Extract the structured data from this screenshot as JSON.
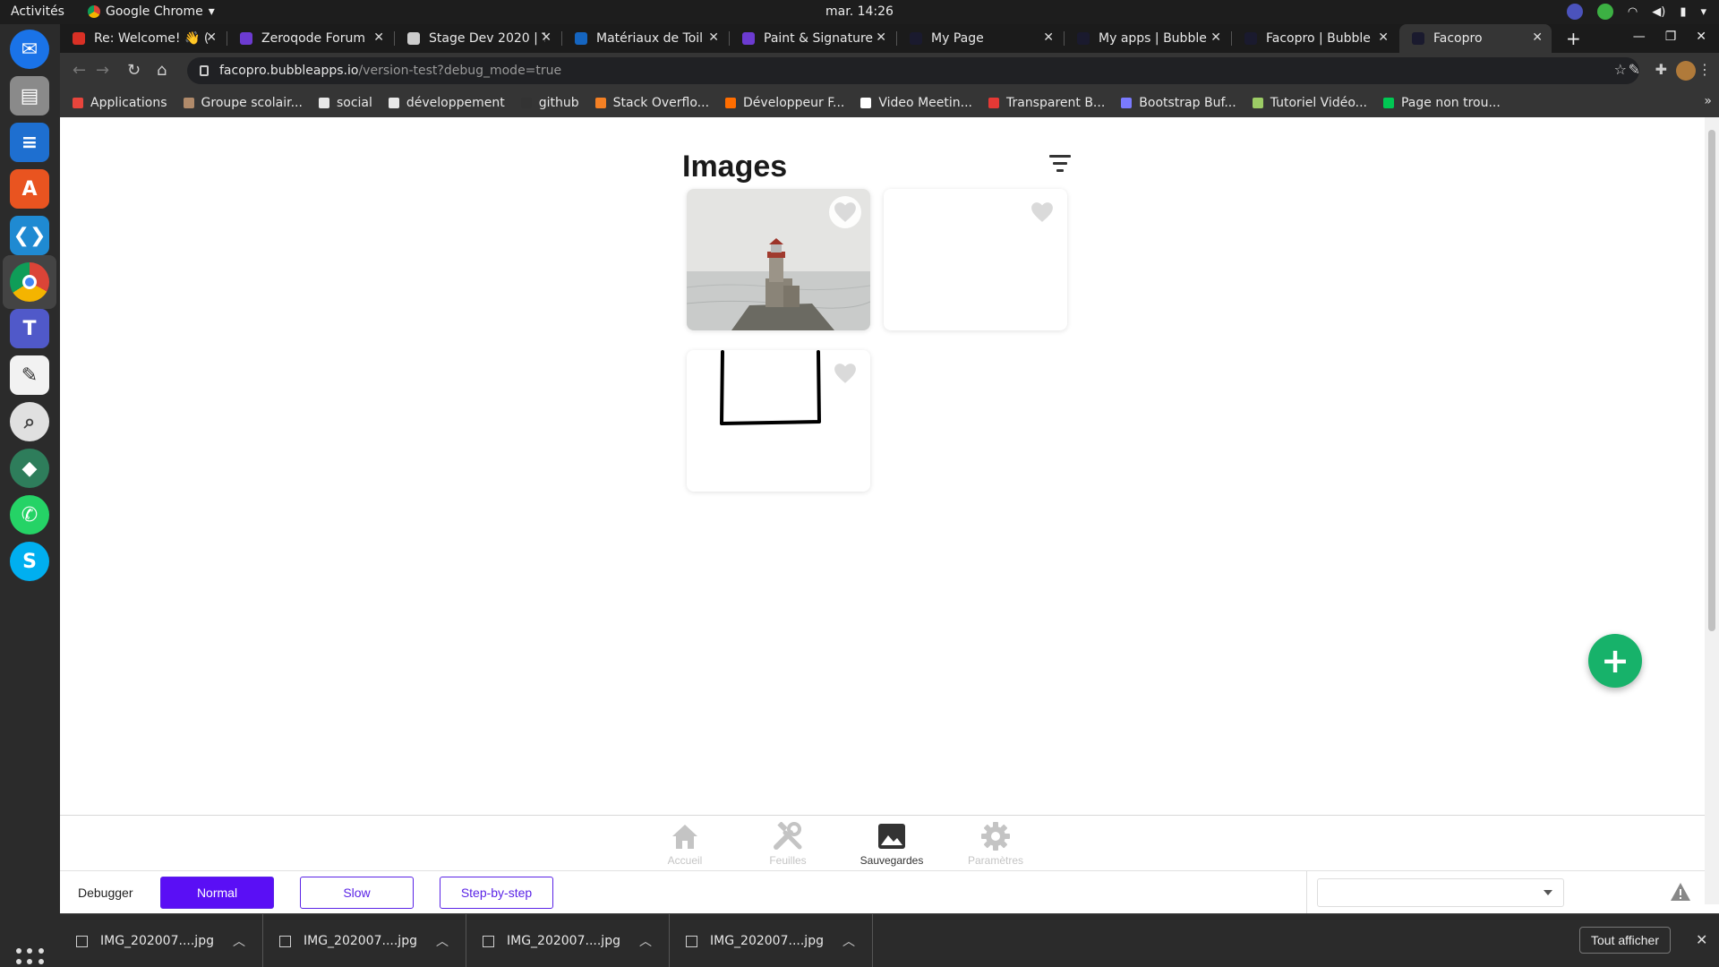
{
  "system": {
    "activities": "Activités",
    "app_menu": "Google Chrome",
    "clock": "mar. 14:26"
  },
  "tabs": [
    {
      "title": "Re: Welcome! 👋 (",
      "color": "#d93025"
    },
    {
      "title": "Zeroqode Forum",
      "color": "#6c3bd1"
    },
    {
      "title": "Stage Dev 2020 | T",
      "color": "#cccccc"
    },
    {
      "title": "Matériaux de Toil",
      "color": "#1565c0"
    },
    {
      "title": "Paint & Signature",
      "color": "#6c3bd1"
    },
    {
      "title": "My Page",
      "color": "#1a1a2e"
    },
    {
      "title": "My apps | Bubble",
      "color": "#1a1a2e"
    },
    {
      "title": "Facopro | Bubble",
      "color": "#1a1a2e"
    },
    {
      "title": "Facopro",
      "color": "#1a1a2e",
      "active": true
    }
  ],
  "address_bar": {
    "host": "facopro.bubbleapps.io",
    "path": "/version-test?debug_mode=true"
  },
  "bookmarks": [
    {
      "label": "Applications",
      "color": "#e8453c"
    },
    {
      "label": "Groupe scolair...",
      "color": "#b08a6a"
    },
    {
      "label": "social",
      "color": "#e8e8e8"
    },
    {
      "label": "développement",
      "color": "#e8e8e8"
    },
    {
      "label": "github",
      "color": "#333333"
    },
    {
      "label": "Stack Overflo...",
      "color": "#f48024"
    },
    {
      "label": "Développeur F...",
      "color": "#ff6d00"
    },
    {
      "label": "Video Meetin...",
      "color": "#ffffff"
    },
    {
      "label": "Transparent B...",
      "color": "#e53935"
    },
    {
      "label": "Bootstrap Buf...",
      "color": "#7a7aff"
    },
    {
      "label": "Tutoriel Vidéo...",
      "color": "#9ccc65"
    },
    {
      "label": "Page non trou...",
      "color": "#00c853"
    }
  ],
  "page": {
    "title": "Images",
    "accent": "#17b26a"
  },
  "bottom_nav": [
    {
      "label": "Accueil",
      "icon": "home-icon"
    },
    {
      "label": "Feuilles",
      "icon": "tools-icon"
    },
    {
      "label": "Sauvegardes",
      "icon": "image-icon",
      "active": true
    },
    {
      "label": "Paramètres",
      "icon": "gear-icon"
    }
  ],
  "debugger": {
    "label": "Debugger",
    "modes": [
      "Normal",
      "Slow",
      "Step-by-step"
    ],
    "active_mode": "Normal",
    "accent": "#5a0ff5"
  },
  "downloads": {
    "files": [
      "IMG_202007....jpg",
      "IMG_202007....jpg",
      "IMG_202007....jpg",
      "IMG_202007....jpg"
    ],
    "show_all": "Tout afficher"
  }
}
